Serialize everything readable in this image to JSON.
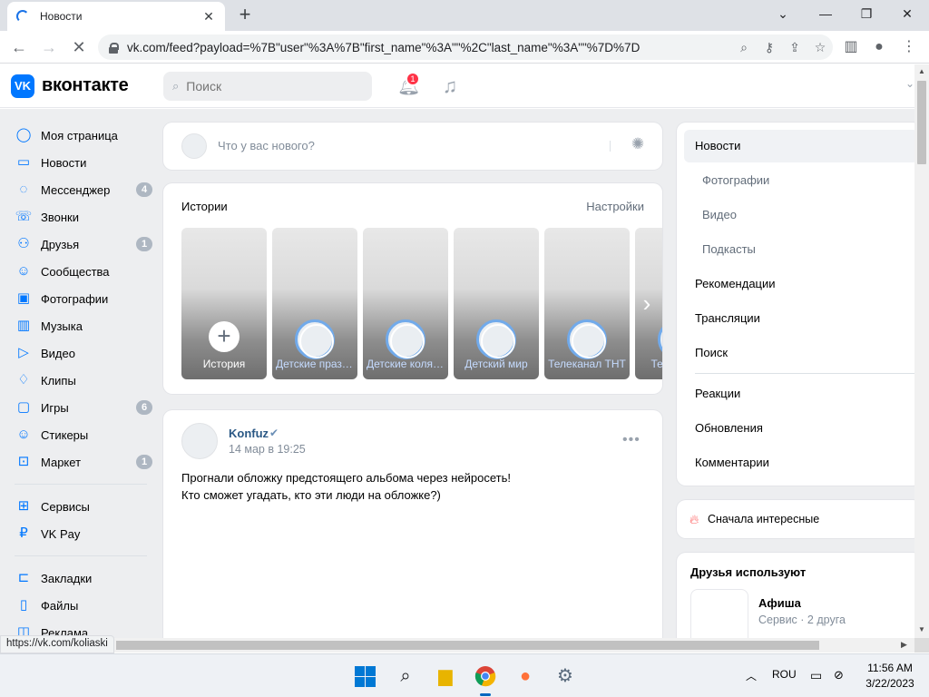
{
  "browser": {
    "tab_title": "Новости",
    "tab_close": "✕",
    "new_tab": "+",
    "url": "vk.com/feed?payload=%7B\"user\"%3A%7B\"first_name\"%3A\"\"%2C\"last_name\"%3A\"\"%7D%7D",
    "status_url": "https://vk.com/koliaski",
    "min": "⌄",
    "minimize": "—",
    "maximize": "❐",
    "close": "✕"
  },
  "vk": {
    "logo": "VK",
    "brand": "вконтакте",
    "search_placeholder": "Поиск",
    "notifications_count": "1"
  },
  "left_menu": {
    "items": [
      {
        "label": "Моя страница",
        "icon": "user-circle-icon",
        "glyph": "◯",
        "badge": ""
      },
      {
        "label": "Новости",
        "icon": "news-icon",
        "glyph": "▭",
        "badge": ""
      },
      {
        "label": "Мессенджер",
        "icon": "messenger-icon",
        "glyph": "◌",
        "badge": "4"
      },
      {
        "label": "Звонки",
        "icon": "phone-icon",
        "glyph": "☏",
        "badge": ""
      },
      {
        "label": "Друзья",
        "icon": "friends-icon",
        "glyph": "⚇",
        "badge": "1"
      },
      {
        "label": "Сообщества",
        "icon": "communities-icon",
        "glyph": "☺",
        "badge": ""
      },
      {
        "label": "Фотографии",
        "icon": "photos-icon",
        "glyph": "▣",
        "badge": ""
      },
      {
        "label": "Музыка",
        "icon": "music-icon",
        "glyph": "▥",
        "badge": ""
      },
      {
        "label": "Видео",
        "icon": "video-icon",
        "glyph": "▷",
        "badge": ""
      },
      {
        "label": "Клипы",
        "icon": "clips-icon",
        "glyph": "♢",
        "badge": ""
      },
      {
        "label": "Игры",
        "icon": "games-icon",
        "glyph": "▢",
        "badge": "6"
      },
      {
        "label": "Стикеры",
        "icon": "stickers-icon",
        "glyph": "☺",
        "badge": ""
      },
      {
        "label": "Маркет",
        "icon": "market-icon",
        "glyph": "⊡",
        "badge": "1"
      }
    ],
    "items2": [
      {
        "label": "Сервисы",
        "icon": "services-icon",
        "glyph": "⊞"
      },
      {
        "label": "VK Pay",
        "icon": "vkpay-icon",
        "glyph": "₽"
      }
    ],
    "items3": [
      {
        "label": "Закладки",
        "icon": "bookmarks-icon",
        "glyph": "⊏"
      },
      {
        "label": "Файлы",
        "icon": "files-icon",
        "glyph": "▯"
      },
      {
        "label": "Реклама",
        "icon": "ads-icon",
        "glyph": "◫"
      }
    ]
  },
  "composer": {
    "placeholder": "Что у вас нового?"
  },
  "stories": {
    "title": "Истории",
    "settings": "Настройки",
    "items": [
      {
        "label": "История"
      },
      {
        "label": "Детские праздники"
      },
      {
        "label": "Детские коляски"
      },
      {
        "label": "Детский мир"
      },
      {
        "label": "Телеканал ТНТ"
      },
      {
        "label": "Телеканал"
      }
    ]
  },
  "post": {
    "author": "Konfuz",
    "date": "14 мар в 19:25",
    "more": "•••",
    "line1": "Прогнали обложку предстоящего альбома через нейросеть!",
    "line2": "Кто сможет угадать, кто эти люди на обложке?)"
  },
  "right_nav": {
    "items": [
      {
        "label": "Новости",
        "kind": "active"
      },
      {
        "label": "Фотографии",
        "kind": "sub"
      },
      {
        "label": "Видео",
        "kind": "sub"
      },
      {
        "label": "Подкасты",
        "kind": "sub"
      },
      {
        "label": "Рекомендации",
        "kind": ""
      },
      {
        "label": "Трансляции",
        "kind": ""
      },
      {
        "label": "Поиск",
        "kind": ""
      }
    ],
    "items2": [
      {
        "label": "Реакции"
      },
      {
        "label": "Обновления"
      },
      {
        "label": "Комментарии"
      }
    ]
  },
  "interest": {
    "label": "Сначала интересные"
  },
  "friends_use": {
    "title": "Друзья используют",
    "app_name": "Афиша",
    "app_sub": "Сервис · 2 друга"
  },
  "taskbar": {
    "lang": "ROU",
    "time": "11:56 AM",
    "date": "3/22/2023"
  },
  "colors": {
    "accent": "#0077ff",
    "link": "#2a5885",
    "badge": "#aeb7c2",
    "notify": "#ff3347"
  }
}
